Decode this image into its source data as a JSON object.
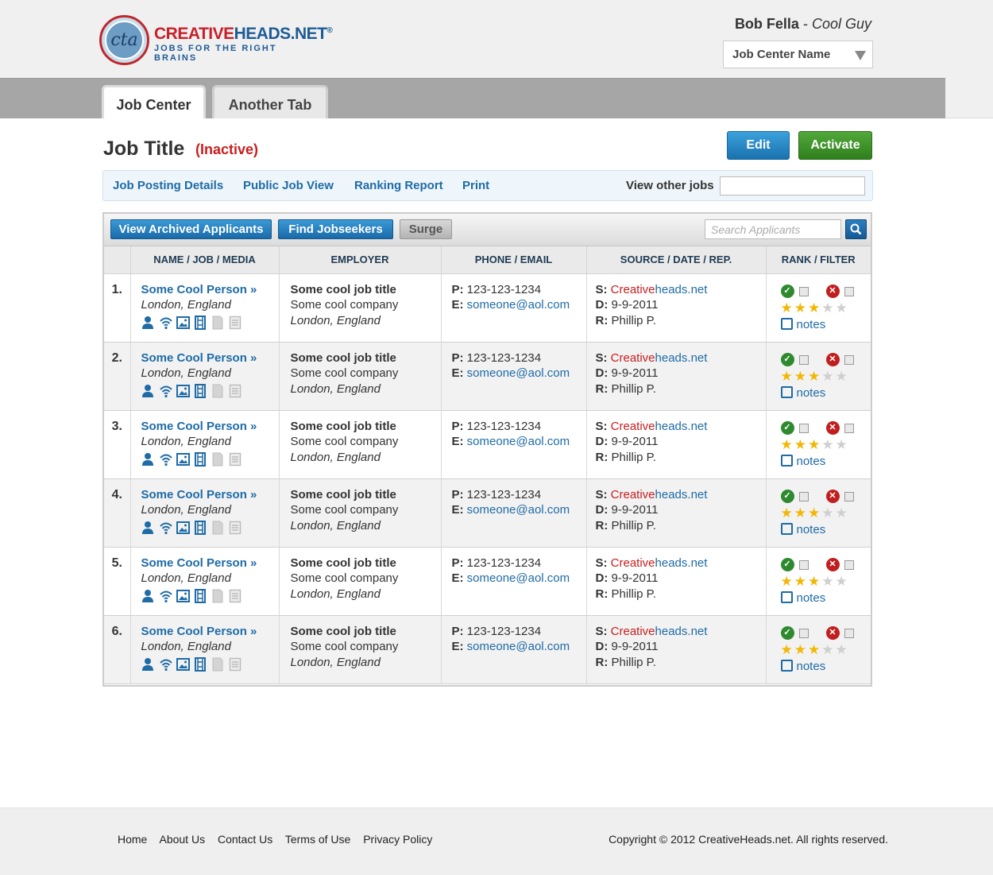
{
  "brand": {
    "name_part1": "CREATIVE",
    "name_part2": "HEADS.NET",
    "registered": "®",
    "tagline": "JOBS FOR THE RIGHT BRAINS",
    "seal_text": "cta"
  },
  "user": {
    "name": "Bob Fella",
    "separator": " - ",
    "role": "Cool Guy"
  },
  "job_center_select": {
    "value": "Job Center Name"
  },
  "tabs": [
    {
      "label": "Job Center",
      "active": true
    },
    {
      "label": "Another Tab",
      "active": false
    }
  ],
  "job": {
    "title": "Job Title",
    "status": "(Inactive)"
  },
  "actions": {
    "edit": "Edit",
    "activate": "Activate"
  },
  "subnav": {
    "links": [
      "Job Posting Details",
      "Public Job View",
      "Ranking Report",
      "Print"
    ],
    "other_jobs_label": "View other jobs",
    "other_jobs_value": ""
  },
  "toolbar": {
    "archived": "View Archived Applicants",
    "find": "Find Jobseekers",
    "surge": "Surge",
    "search_placeholder": "Search Applicants"
  },
  "table": {
    "headers": [
      "",
      "NAME / JOB / MEDIA",
      "EMPLOYER",
      "PHONE / EMAIL",
      "SOURCE / DATE / REP.",
      "RANK / FILTER"
    ],
    "rows": [
      {
        "num": "1.",
        "name": "Some Cool Person »",
        "location": "London, England",
        "job_title": "Some cool job title",
        "company": "Some cool company",
        "emp_location": "London, England",
        "phone_label": "P:",
        "phone": "123-123-1234",
        "email_label": "E:",
        "email": "someone@aol.com",
        "source_label": "S:",
        "source_red": "Creative",
        "source_blue": "heads.net",
        "date_label": "D:",
        "date": "9-9-2011",
        "rep_label": "R:",
        "rep": "Phillip P.",
        "rating": 3,
        "notes": "notes"
      },
      {
        "num": "2.",
        "name": "Some Cool Person »",
        "location": "London, England",
        "job_title": "Some cool job title",
        "company": "Some cool company",
        "emp_location": "London, England",
        "phone_label": "P:",
        "phone": "123-123-1234",
        "email_label": "E:",
        "email": "someone@aol.com",
        "source_label": "S:",
        "source_red": "Creative",
        "source_blue": "heads.net",
        "date_label": "D:",
        "date": "9-9-2011",
        "rep_label": "R:",
        "rep": "Phillip P.",
        "rating": 3,
        "notes": "notes"
      },
      {
        "num": "3.",
        "name": "Some Cool Person »",
        "location": "London, England",
        "job_title": "Some cool job title",
        "company": "Some cool company",
        "emp_location": "London, England",
        "phone_label": "P:",
        "phone": "123-123-1234",
        "email_label": "E:",
        "email": "someone@aol.com",
        "source_label": "S:",
        "source_red": "Creative",
        "source_blue": "heads.net",
        "date_label": "D:",
        "date": "9-9-2011",
        "rep_label": "R:",
        "rep": "Phillip P.",
        "rating": 3,
        "notes": "notes"
      },
      {
        "num": "4.",
        "name": "Some Cool Person »",
        "location": "London, England",
        "job_title": "Some cool job title",
        "company": "Some cool company",
        "emp_location": "London, England",
        "phone_label": "P:",
        "phone": "123-123-1234",
        "email_label": "E:",
        "email": "someone@aol.com",
        "source_label": "S:",
        "source_red": "Creative",
        "source_blue": "heads.net",
        "date_label": "D:",
        "date": "9-9-2011",
        "rep_label": "R:",
        "rep": "Phillip P.",
        "rating": 3,
        "notes": "notes"
      },
      {
        "num": "5.",
        "name": "Some Cool Person »",
        "location": "London, England",
        "job_title": "Some cool job title",
        "company": "Some cool company",
        "emp_location": "London, England",
        "phone_label": "P:",
        "phone": "123-123-1234",
        "email_label": "E:",
        "email": "someone@aol.com",
        "source_label": "S:",
        "source_red": "Creative",
        "source_blue": "heads.net",
        "date_label": "D:",
        "date": "9-9-2011",
        "rep_label": "R:",
        "rep": "Phillip P.",
        "rating": 3,
        "notes": "notes"
      },
      {
        "num": "6.",
        "name": "Some Cool Person »",
        "location": "London, England",
        "job_title": "Some cool job title",
        "company": "Some cool company",
        "emp_location": "London, England",
        "phone_label": "P:",
        "phone": "123-123-1234",
        "email_label": "E:",
        "email": "someone@aol.com",
        "source_label": "S:",
        "source_red": "Creative",
        "source_blue": "heads.net",
        "date_label": "D:",
        "date": "9-9-2011",
        "rep_label": "R:",
        "rep": "Phillip P.",
        "rating": 3,
        "notes": "notes"
      }
    ],
    "max_rating": 5,
    "media_icons": [
      "person-icon",
      "wifi-icon",
      "image-icon",
      "film-icon",
      "document-icon",
      "notebook-icon"
    ]
  },
  "footer": {
    "links": [
      "Home",
      "About Us",
      "Contact Us",
      "Terms of Use",
      "Privacy Policy"
    ],
    "copyright": "Copyright © 2012 CreativeHeads.net. All rights reserved."
  },
  "colors": {
    "accent_blue": "#1e6ba6",
    "brand_red": "#c8202a",
    "status_red": "#c81e1e",
    "activate_green": "#2f7f1d",
    "star_gold": "#f2b705"
  }
}
